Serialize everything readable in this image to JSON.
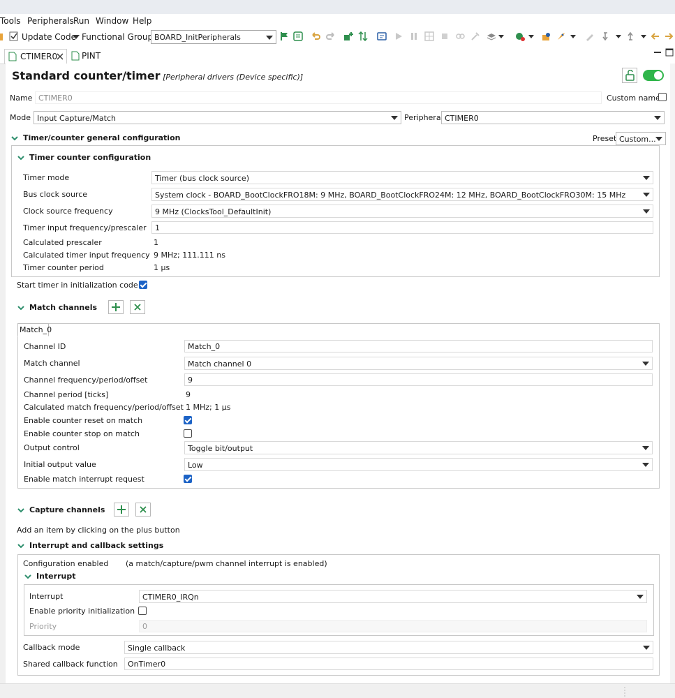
{
  "menu": {
    "items": [
      "Tools",
      "Peripherals",
      "Run",
      "Window",
      "Help"
    ]
  },
  "toolbar": {
    "update_code": "Update Code",
    "functional_group_label": "Functional Group",
    "functional_group_value": "BOARD_InitPeripherals"
  },
  "tabs": [
    {
      "label": "CTIMER0"
    },
    {
      "label": "PINT"
    }
  ],
  "header": {
    "title": "Standard counter/timer",
    "subtitle": "[Peripheral drivers (Device specific)]"
  },
  "name_row": {
    "label": "Name",
    "value": "CTIMER0",
    "custom_name_label": "Custom name",
    "custom_name_checked": false
  },
  "mode_row": {
    "label": "Mode",
    "value": "Input Capture/Match",
    "peripheral_label": "Peripheral",
    "peripheral_value": "CTIMER0"
  },
  "general": {
    "title": "Timer/counter general configuration",
    "preset_label": "Preset",
    "preset_value": "Custom...",
    "counter_config": {
      "title": "Timer counter configuration",
      "timer_mode_label": "Timer mode",
      "timer_mode_value": "Timer (bus clock source)",
      "bus_clock_label": "Bus clock source",
      "bus_clock_value": "System clock - BOARD_BootClockFRO18M: 9 MHz, BOARD_BootClockFRO24M: 12 MHz, BOARD_BootClockFRO30M: 15 MHz",
      "clock_freq_label": "Clock source frequency",
      "clock_freq_value": "9 MHz (ClocksTool_DefaultInit)",
      "prescaler_label": "Timer input frequency/prescaler",
      "prescaler_value": "1",
      "calc_prescaler_label": "Calculated prescaler",
      "calc_prescaler_value": "1",
      "calc_input_freq_label": "Calculated timer input frequency",
      "calc_input_freq_value": "9 MHz; 111.111 ns",
      "counter_period_label": "Timer counter period",
      "counter_period_value": "1 µs"
    },
    "start_timer_label": "Start timer in initialization code",
    "start_timer_checked": true
  },
  "match": {
    "title": "Match channels",
    "tab_label": "Match_0",
    "channel_id_label": "Channel ID",
    "channel_id_value": "Match_0",
    "match_channel_label": "Match channel",
    "match_channel_value": "Match channel 0",
    "channel_freq_label": "Channel frequency/period/offset",
    "channel_freq_value": "9",
    "channel_period_label": "Channel period [ticks]",
    "channel_period_value": "9",
    "calc_match_label": "Calculated match frequency/period/offset",
    "calc_match_value": "1 MHz; 1 µs",
    "reset_label": "Enable counter reset on match",
    "reset_checked": true,
    "stop_label": "Enable counter stop on match",
    "stop_checked": false,
    "output_control_label": "Output control",
    "output_control_value": "Toggle bit/output",
    "initial_output_label": "Initial output value",
    "initial_output_value": "Low",
    "interrupt_label": "Enable match interrupt request",
    "interrupt_checked": true
  },
  "capture": {
    "title": "Capture channels",
    "hint": "Add an item by clicking on the plus button"
  },
  "interrupt_settings": {
    "title": "Interrupt and callback settings",
    "config_enabled_label": "Configuration enabled",
    "config_enabled_value": "(a match/capture/pwm channel interrupt is enabled)",
    "interrupt_group_title": "Interrupt",
    "interrupt_label": "Interrupt",
    "interrupt_value": "CTIMER0_IRQn",
    "priority_init_label": "Enable priority initialization",
    "priority_init_checked": false,
    "priority_label": "Priority",
    "priority_value": "0",
    "callback_mode_label": "Callback mode",
    "callback_mode_value": "Single callback",
    "shared_callback_label": "Shared callback function",
    "shared_callback_value": "OnTimer0"
  },
  "colors": {
    "toggle_on": "#2fb54a",
    "checkbox": "#1d63c6",
    "icon_green": "#2f8f4e"
  }
}
